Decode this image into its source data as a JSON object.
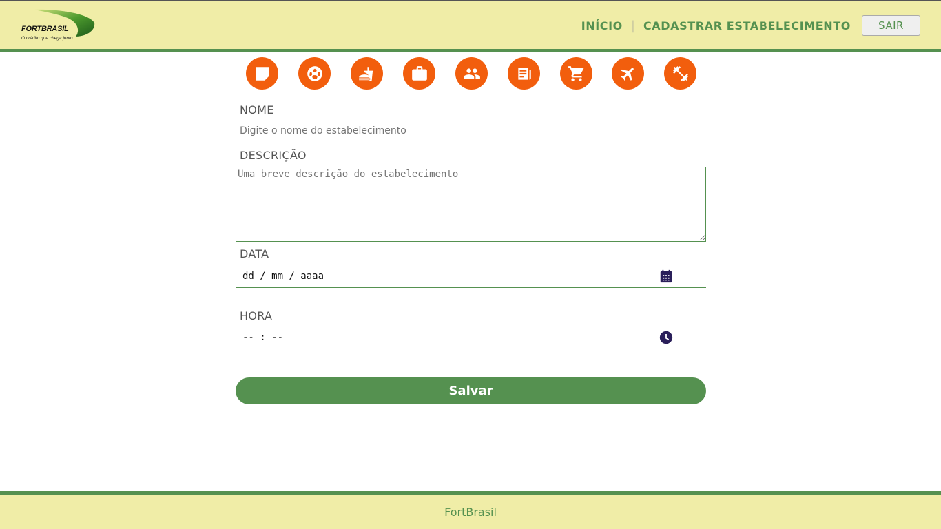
{
  "header": {
    "logo_name": "FORTBRASIL",
    "logo_tagline": "O crédito que chega junto.",
    "nav": {
      "inicio": "INÍCIO",
      "separator": "|",
      "cadastrar": "CADASTRAR ESTABELECIMENTO"
    },
    "logout_label": "SAIR"
  },
  "categories": [
    {
      "icon": "note-icon"
    },
    {
      "icon": "soccer-ball-icon"
    },
    {
      "icon": "fastfood-icon"
    },
    {
      "icon": "briefcase-icon"
    },
    {
      "icon": "people-icon"
    },
    {
      "icon": "news-icon"
    },
    {
      "icon": "shopping-cart-icon"
    },
    {
      "icon": "flight-icon"
    },
    {
      "icon": "fitness-icon"
    }
  ],
  "form": {
    "nome_label": "NOME",
    "nome_placeholder": "Digite o nome do estabelecimento",
    "descricao_label": "DESCRIÇÃO",
    "descricao_placeholder": "Uma breve descrição do estabelecimento",
    "data_label": "DATA",
    "data_value": "dd / mm / aaaa",
    "hora_label": "HORA",
    "hora_value": "-- : --",
    "submit_label": "Salvar"
  },
  "footer": {
    "text": "FortBrasil"
  },
  "colors": {
    "header_bg": "#f0eda7",
    "accent_green": "#559150",
    "category_orange": "#f25e0d",
    "icon_dark": "#2a1f5a"
  }
}
